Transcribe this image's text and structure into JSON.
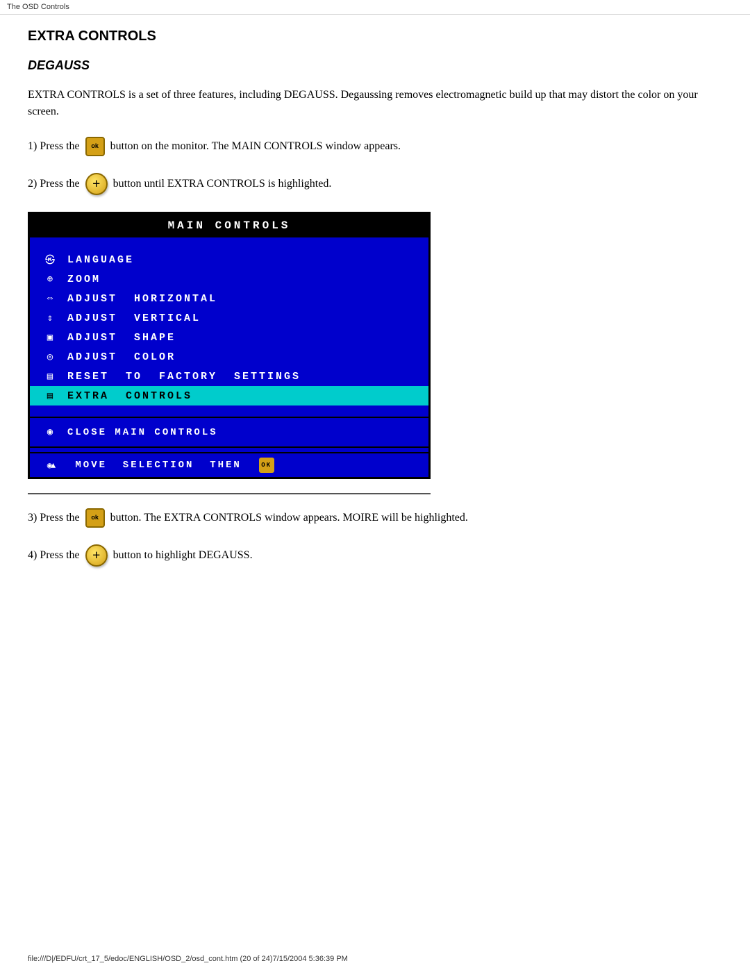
{
  "browser_bar": "The OSD Controls",
  "status_bar": "file:///D|/EDFU/crt_17_5/edoc/ENGLISH/OSD_2/osd_cont.htm (20 of 24)7/15/2004 5:36:39 PM",
  "page_title": "EXTRA CONTROLS",
  "section_title": "DEGAUSS",
  "intro_text": "EXTRA CONTROLS is a set of three features, including DEGAUSS. Degaussing removes electromagnetic build up that may distort the color on your screen.",
  "steps": [
    {
      "number": "1)",
      "prefix": "Press the",
      "button_type": "osd",
      "button_label": "ok",
      "suffix": "button on the monitor. The MAIN CONTROLS window appears."
    },
    {
      "number": "2)",
      "prefix": "Press the",
      "button_type": "plus",
      "button_label": "+",
      "suffix": "button until EXTRA CONTROLS is highlighted."
    },
    {
      "number": "3)",
      "prefix": "Press the",
      "button_type": "osd",
      "button_label": "ok",
      "suffix": "button. The EXTRA CONTROLS window appears. MOIRE will be highlighted."
    },
    {
      "number": "4)",
      "prefix": "Press the",
      "button_type": "plus",
      "button_label": "+",
      "suffix": "button to highlight DEGAUSS."
    }
  ],
  "screen": {
    "title": "MAIN  CONTROLS",
    "menu_items": [
      {
        "icon": "language-icon",
        "icon_char": "㉿",
        "label": "LANGUAGE",
        "highlighted": false
      },
      {
        "icon": "zoom-icon",
        "icon_char": "⊕",
        "label": "ZOOM",
        "highlighted": false
      },
      {
        "icon": "horiz-icon",
        "icon_char": "↔",
        "label": "ADJUST  HORIZONTAL",
        "highlighted": false
      },
      {
        "icon": "vert-icon",
        "icon_char": "↕",
        "label": "ADJUST  VERTICAL",
        "highlighted": false
      },
      {
        "icon": "shape-icon",
        "icon_char": "▣",
        "label": "ADJUST  SHAPE",
        "highlighted": false
      },
      {
        "icon": "color-icon",
        "icon_char": "◎",
        "label": "ADJUST  COLOR",
        "highlighted": false
      },
      {
        "icon": "reset-icon",
        "icon_char": "▤",
        "label": "RESET  TO  FACTORY  SETTINGS",
        "highlighted": false
      },
      {
        "icon": "extra-icon",
        "icon_char": "▤",
        "label": "EXTRA  CONTROLS",
        "highlighted": true
      }
    ],
    "close_label": "CLOSE  MAIN  CONTROLS",
    "nav_label": "MOVE  SELECTION  THEN",
    "close_icon": "◉",
    "nav_icons_left": "◉▲",
    "ok_label": "OK"
  }
}
